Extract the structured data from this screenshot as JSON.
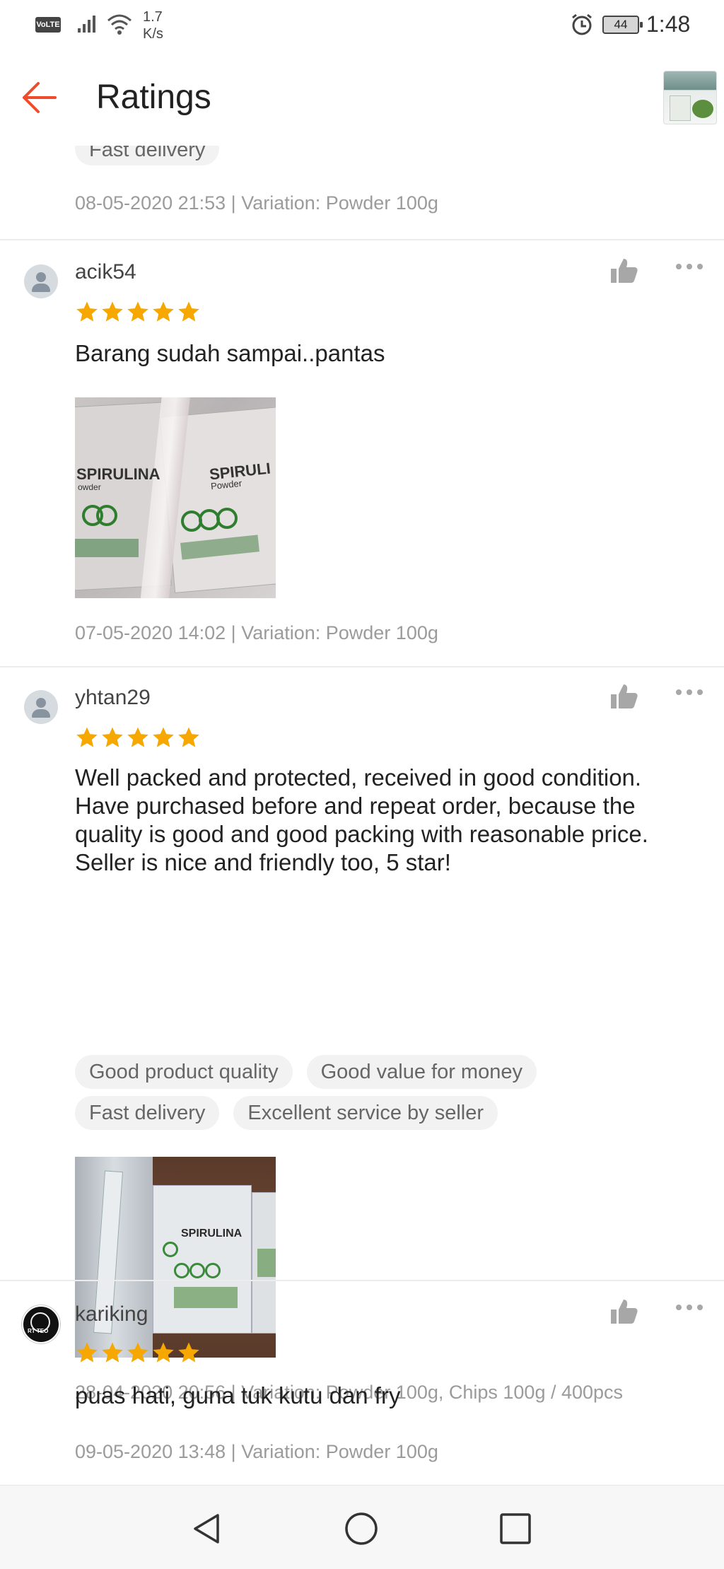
{
  "status_bar": {
    "network_badge": "VoLTE",
    "speed_value": "1.7",
    "speed_unit": "K/s",
    "battery": "44",
    "time": "1:48",
    "icons": [
      "signal-icon",
      "wifi-icon",
      "alarm-icon",
      "battery-icon"
    ]
  },
  "header": {
    "title": "Ratings",
    "back_icon": "arrow-left-icon",
    "accent_color": "#ee4d2d"
  },
  "partial_review": {
    "tag": "Fast delivery",
    "meta": "08-05-2020 21:53 | Variation: Powder 100g"
  },
  "reviews": [
    {
      "username": "acik54",
      "rating": 5,
      "comment": "Barang sudah sampai..pantas",
      "tags": [],
      "photo_labels": [
        "SPIRULINA",
        "SPIRULI",
        "Powder",
        "owder"
      ],
      "meta": "07-05-2020 14:02 | Variation: Powder 100g"
    },
    {
      "username": "yhtan29",
      "rating": 5,
      "comment": "Well packed and protected, received in good condition. Have purchased before and repeat order, because the quality is good and good packing with reasonable price. Seller is nice and friendly too, 5 star!",
      "tags": [
        "Good product quality",
        "Good value for money",
        "Fast delivery",
        "Excellent service by seller"
      ],
      "photo_labels": [
        "SPIRULINA"
      ],
      "meta": "28-04-2020 20:56 | Variation: Powder 100g, Chips 100g / 400pcs"
    },
    {
      "username": "kariking",
      "rating": 5,
      "comment": "puas hati, guna tuk kutu dan fry",
      "tags": [],
      "avatar_text": "RT TEO",
      "meta": "09-05-2020 13:48 | Variation: Powder 100g"
    }
  ],
  "colors": {
    "star": "#f6a700",
    "meta_text": "#9b9b9b",
    "tag_bg": "#f2f2f2"
  },
  "nav": {
    "icons": [
      "nav-back-icon",
      "nav-home-icon",
      "nav-recent-icon"
    ]
  }
}
